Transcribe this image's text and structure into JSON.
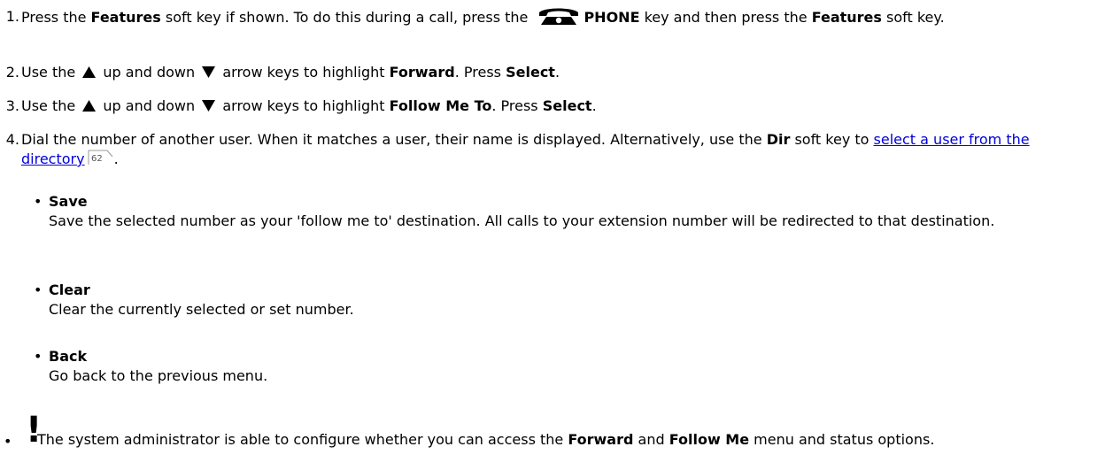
{
  "steps": [
    {
      "number": "1.",
      "parts": {
        "a": "Press the ",
        "b": "Features",
        "c": " soft key if shown. To do this during a call, press the ",
        "d": "PHONE",
        "e": " key and then press the ",
        "f": "Features",
        "g": " soft key."
      }
    },
    {
      "number": "2.",
      "parts": {
        "a": "Use the ",
        "b": " up and down ",
        "c": " arrow keys to highlight ",
        "d": "Forward",
        "e": ". Press ",
        "f": "Select",
        "g": "."
      }
    },
    {
      "number": "3.",
      "parts": {
        "a": "Use the ",
        "b": " up and down ",
        "c": " arrow keys to highlight ",
        "d": "Follow Me To",
        "e": ". Press ",
        "f": "Select",
        "g": "."
      }
    },
    {
      "number": "4.",
      "parts": {
        "a": "Dial the number of another user. When it matches a user, their name is displayed. Alternatively, use the ",
        "b": "Dir",
        "c": " soft key to ",
        "link": "select a user from the directory",
        "pageref": "62",
        "d": "."
      }
    }
  ],
  "options": [
    {
      "title": "Save",
      "description": "Save the selected number as your 'follow me to' destination. All calls to your extension number will be redirected to that destination."
    },
    {
      "title": "Clear",
      "description": "Clear the currently selected or set number."
    },
    {
      "title": "Back",
      "description": "Go back to the previous menu."
    }
  ],
  "note": {
    "symbol": "!",
    "a": "The system administrator is able to configure whether you can access the ",
    "b": "Forward",
    "c": " and ",
    "d": "Follow Me",
    "e": " menu and status options."
  },
  "bullet_char": "•",
  "icons": {
    "phone": "phone-handset-icon",
    "up": "up-arrow-icon",
    "down": "down-arrow-icon",
    "pageref": "page-reference-icon"
  }
}
